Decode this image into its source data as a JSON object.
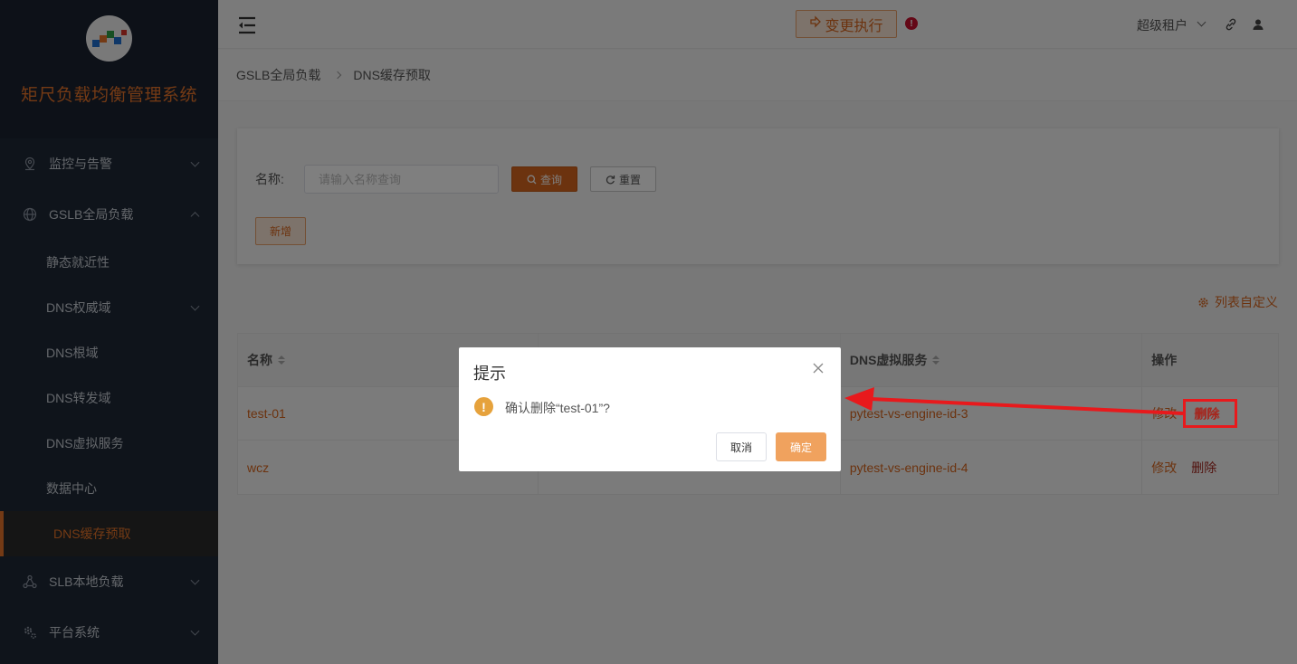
{
  "app": {
    "title": "矩尺负载均衡管理系统"
  },
  "header": {
    "exec_button": "变更执行",
    "alert_badge": "!",
    "tenant": "超级租户",
    "icons": [
      "menu-toggle-icon",
      "link-icon",
      "user-icon"
    ]
  },
  "sidebar": {
    "items": [
      {
        "label": "监控与告警",
        "icon": "location-pin-icon"
      },
      {
        "label": "GSLB全局负载",
        "icon": "globe-icon"
      },
      {
        "label": "SLB本地负载",
        "icon": "network-nodes-icon"
      },
      {
        "label": "平台系统",
        "icon": "gears-icon"
      }
    ],
    "subitems": [
      {
        "label": "静态就近性"
      },
      {
        "label": "DNS权威域"
      },
      {
        "label": "DNS根域"
      },
      {
        "label": "DNS转发域"
      },
      {
        "label": "DNS虚拟服务"
      },
      {
        "label": "数据中心"
      },
      {
        "label": "DNS缓存预取"
      }
    ]
  },
  "breadcrumb": [
    "GSLB全局负载",
    "DNS缓存预取"
  ],
  "search": {
    "label": "名称:",
    "placeholder": "请输入名称查询",
    "query_button": "查询",
    "reset_button": "重置",
    "add_button": "新增"
  },
  "customize_label": "列表自定义",
  "table": {
    "headers": [
      "名称",
      "",
      "DNS虚拟服务",
      "操作"
    ],
    "rows": [
      {
        "name": "test-01",
        "col2": "",
        "vs": "pytest-vs-engine-id-3",
        "edit": "修改",
        "delete": "删除"
      },
      {
        "name": "wcz",
        "col2": "",
        "vs": "pytest-vs-engine-id-4",
        "edit": "修改",
        "delete": "删除"
      }
    ]
  },
  "dialog": {
    "title": "提示",
    "message": "确认删除“test-01”?",
    "cancel": "取消",
    "confirm": "确定",
    "warn_glyph": "!"
  },
  "colors": {
    "accent": "#d9661e",
    "sidebar_bg": "#1f2937",
    "danger": "#a5271f",
    "annotation": "#e8191c",
    "confirm": "#f0a25e"
  }
}
